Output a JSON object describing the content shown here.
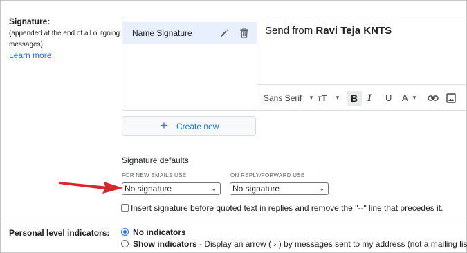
{
  "signature": {
    "label": "Signature:",
    "subtext": "(appended at the end of all outgoing messages)",
    "learn_more": "Learn more",
    "items": [
      {
        "name": "Name Signature"
      }
    ],
    "editor_text_prefix": "Send from ",
    "editor_text_bold": "Ravi Teja KNTS",
    "toolbar": {
      "font": "Sans Serif",
      "size_icon": "text-size-icon",
      "bold": "B",
      "italic": "I",
      "underline": "U",
      "text_color": "A",
      "link_icon": "link-icon",
      "image_icon": "image-icon"
    },
    "create_new": "Create new"
  },
  "defaults": {
    "title": "Signature defaults",
    "new_emails_label": "FOR NEW EMAILS USE",
    "reply_label": "ON REPLY/FORWARD USE",
    "new_emails_value": "No signature",
    "reply_value": "No signature",
    "insert_before_text": "Insert signature before quoted text in replies and remove the \"--\" line that precedes it."
  },
  "personal_level": {
    "label": "Personal level indicators:",
    "options": [
      {
        "label": "No indicators",
        "description": "",
        "selected": true
      },
      {
        "label": "Show indicators",
        "description": " - Display an arrow ( › ) by messages sent to my address (not a mailing list), an",
        "selected": false
      }
    ]
  },
  "colors": {
    "accent": "#1a73e8",
    "selected_item_bg": "#e8f0fe",
    "arrow": "#d9262c"
  }
}
